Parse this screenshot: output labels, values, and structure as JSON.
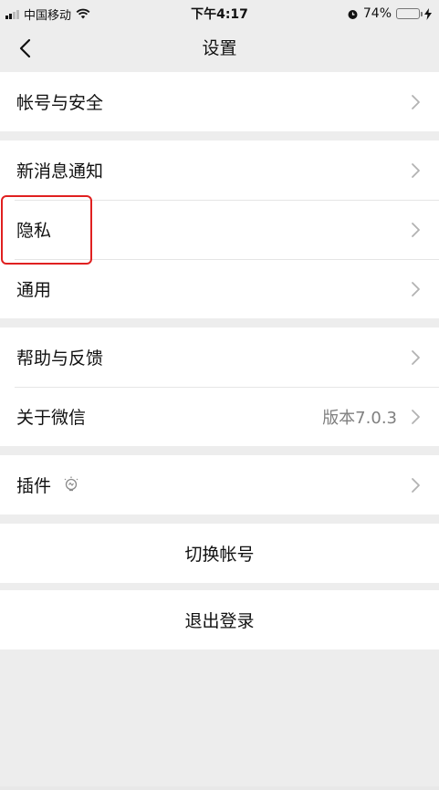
{
  "status_bar": {
    "carrier": "中国移动",
    "time": "下午4:17",
    "battery": "74%",
    "battery_level": 0.74
  },
  "nav": {
    "title": "设置",
    "back_icon": "chevron-left-icon"
  },
  "groups": [
    {
      "items": [
        {
          "label": "帐号与安全"
        }
      ]
    },
    {
      "items": [
        {
          "label": "新消息通知"
        },
        {
          "label": "隐私"
        },
        {
          "label": "通用"
        }
      ]
    },
    {
      "items": [
        {
          "label": "帮助与反馈"
        },
        {
          "label": "关于微信",
          "value": "版本7.0.3"
        }
      ]
    },
    {
      "items": [
        {
          "label": "插件",
          "icon": "lightbulb-icon"
        }
      ]
    }
  ],
  "actions": {
    "switch_account": "切换帐号",
    "logout": "退出登录"
  },
  "annotation": {
    "highlight_color": "#e02020",
    "highlighted_item": "隐私"
  }
}
